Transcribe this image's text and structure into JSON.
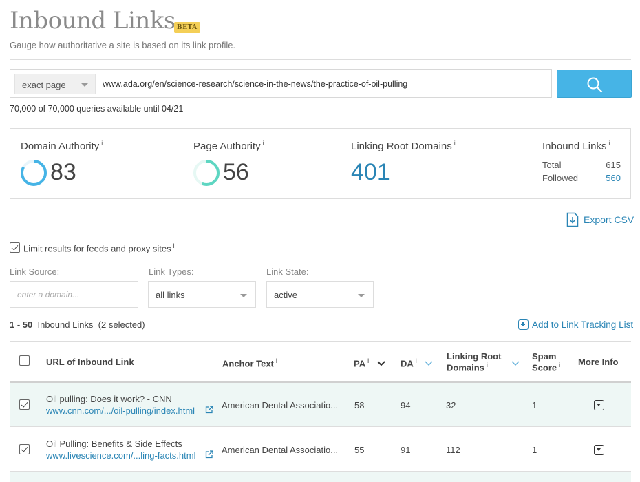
{
  "header": {
    "title": "Inbound Links",
    "badge": "BETA",
    "subtitle": "Gauge how authoritative a site is based on its link profile."
  },
  "search": {
    "scope": "exact page",
    "url": "www.ada.org/en/science-research/science-in-the-news/the-practice-of-oil-pulling",
    "button_icon": "search-icon",
    "quota": "70,000 of 70,000 queries available until 04/21"
  },
  "metrics": {
    "da_label": "Domain Authority",
    "da_value": "83",
    "da_ring_fraction": 0.83,
    "pa_label": "Page Authority",
    "pa_value": "56",
    "pa_ring_fraction": 0.56,
    "lrd_label": "Linking Root Domains",
    "lrd_value": "401",
    "il_label": "Inbound Links",
    "total_label": "Total",
    "total_value": "615",
    "followed_label": "Followed",
    "followed_value": "560",
    "info": "i"
  },
  "export_label": "Export CSV",
  "filters": {
    "limit_label": "Limit results for feeds and proxy sites",
    "limit_checked": true,
    "source_label": "Link Source:",
    "source_placeholder": "enter a domain...",
    "types_label": "Link Types:",
    "types_value": "all links",
    "state_label": "Link State:",
    "state_value": "active"
  },
  "results": {
    "range": "1 - 50",
    "noun": "Inbound Links",
    "selected": "(2 selected)",
    "add_tracking": "Add to Link Tracking List"
  },
  "table": {
    "headers": {
      "url": "URL of Inbound Link",
      "anchor": "Anchor Text",
      "pa": "PA",
      "da": "DA",
      "lrd_line1": "Linking Root",
      "lrd_line2": "Domains",
      "spam_line1": "Spam",
      "spam_line2": "Score",
      "more": "More Info"
    },
    "rows": [
      {
        "title": "Oil pulling: Does it work? - CNN",
        "url": "www.cnn.com/.../oil-pulling/index.html",
        "anchor": "American Dental Associatio...",
        "pa": "58",
        "da": "94",
        "lrd": "32",
        "spam": "1",
        "checked": true
      },
      {
        "title": "Oil Pulling: Benefits & Side Effects",
        "url": "www.livescience.com/...ling-facts.html",
        "anchor": "American Dental Associatio...",
        "pa": "55",
        "da": "91",
        "lrd": "112",
        "spam": "1",
        "checked": true
      }
    ]
  },
  "colors": {
    "accent": "#46b4e6",
    "link": "#2a85b5",
    "da_ring": "#46b4e6",
    "pa_ring": "#5ed6c2",
    "selected_row": "#eef7f5",
    "beta_badge": "#f4cf57"
  }
}
